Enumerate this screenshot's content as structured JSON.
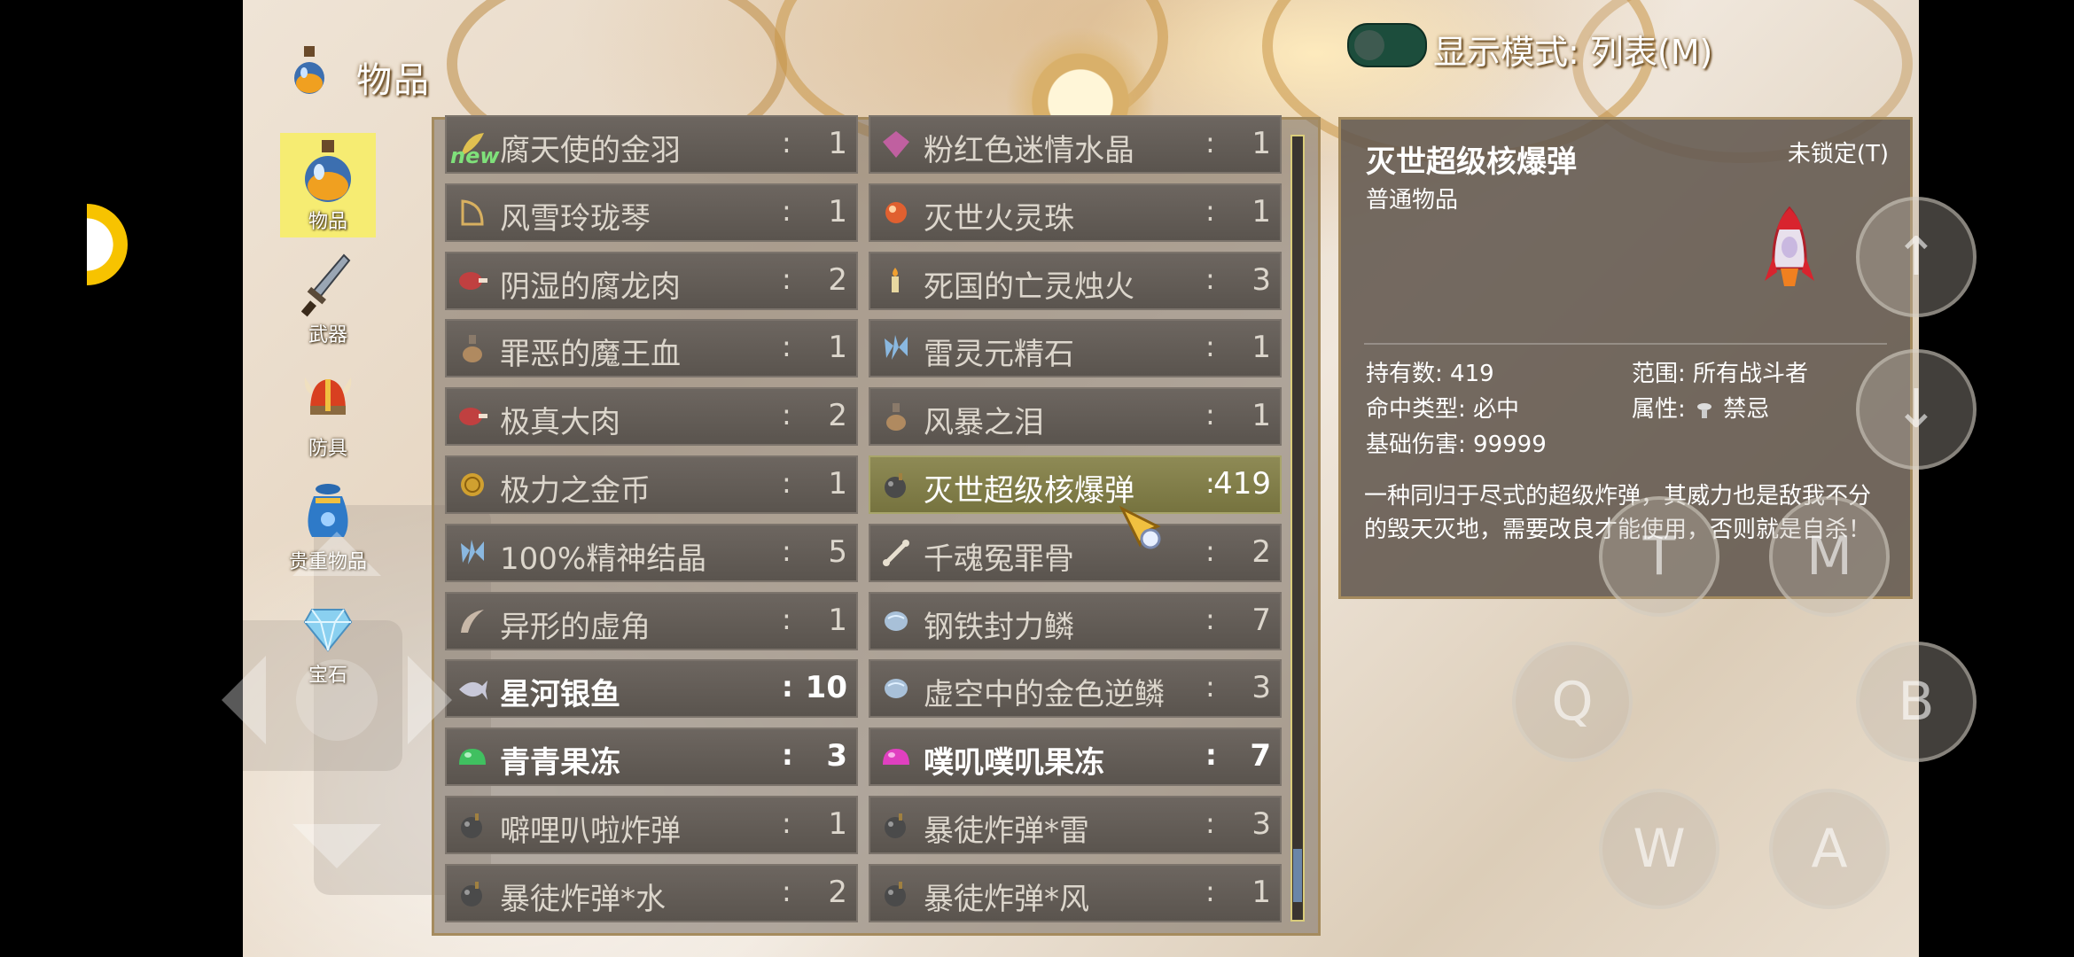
{
  "header": {
    "title": "物品"
  },
  "display_mode": {
    "label": "显示模式: 列表(M)",
    "toggle_on": false
  },
  "categories": [
    {
      "label": "物品",
      "icon": "potion-icon",
      "active": true
    },
    {
      "label": "武器",
      "icon": "sword-icon",
      "active": false
    },
    {
      "label": "防具",
      "icon": "helmet-icon",
      "active": false
    },
    {
      "label": "贵重物品",
      "icon": "treasure-bag-icon",
      "active": false
    },
    {
      "label": "宝石",
      "icon": "gem-icon",
      "active": false
    }
  ],
  "items": [
    {
      "name": "腐天使的金羽",
      "qty": "1",
      "icon": "feather-icon",
      "new_tag": "new"
    },
    {
      "name": "粉红色迷情水晶",
      "qty": "1",
      "icon": "crystal-icon"
    },
    {
      "name": "风雪玲珑琴",
      "qty": "1",
      "icon": "harp-icon"
    },
    {
      "name": "灭世火灵珠",
      "qty": "1",
      "icon": "orb-icon"
    },
    {
      "name": "阴湿的腐龙肉",
      "qty": "2",
      "icon": "meat-icon"
    },
    {
      "name": "死国的亡灵烛火",
      "qty": "3",
      "icon": "candle-icon"
    },
    {
      "name": "罪恶的魔王血",
      "qty": "1",
      "icon": "flask-icon"
    },
    {
      "name": "雷灵元精石",
      "qty": "1",
      "icon": "shard-icon"
    },
    {
      "name": "极真大肉",
      "qty": "2",
      "icon": "meat-icon"
    },
    {
      "name": "风暴之泪",
      "qty": "1",
      "icon": "flask-icon"
    },
    {
      "name": "极力之金币",
      "qty": "1",
      "icon": "coin-icon"
    },
    {
      "name": "灭世超级核爆弹",
      "qty": "419",
      "icon": "bomb-icon",
      "selected": true
    },
    {
      "name": "100%精神结晶",
      "qty": "5",
      "icon": "shard-icon"
    },
    {
      "name": "千魂冤罪骨",
      "qty": "2",
      "icon": "bone-icon"
    },
    {
      "name": "异形的虚角",
      "qty": "1",
      "icon": "horn-icon"
    },
    {
      "name": "钢铁封力鳞",
      "qty": "7",
      "icon": "scale-icon"
    },
    {
      "name": "星河银鱼",
      "qty": "10",
      "icon": "fish-icon",
      "bright": true
    },
    {
      "name": "虚空中的金色逆鳞",
      "qty": "3",
      "icon": "scale-icon"
    },
    {
      "name": "青青果冻",
      "qty": "3",
      "icon": "jelly-green-icon",
      "bright": true
    },
    {
      "name": "噗叽噗叽果冻",
      "qty": "7",
      "icon": "jelly-pink-icon",
      "bright": true
    },
    {
      "name": "噼哩叭啦炸弹",
      "qty": "1",
      "icon": "bomb-icon"
    },
    {
      "name": "暴徒炸弹*雷",
      "qty": "3",
      "icon": "bomb-icon"
    },
    {
      "name": "暴徒炸弹*水",
      "qty": "2",
      "icon": "bomb-icon"
    },
    {
      "name": "暴徒炸弹*风",
      "qty": "1",
      "icon": "bomb-icon"
    }
  ],
  "detail": {
    "title": "灭世超级核爆弹",
    "lock": "未锁定(T)",
    "type": "普通物品",
    "held": "持有数: 419",
    "range": "范围: 所有战斗者",
    "hit": "命中类型: 必中",
    "attr_label": "属性:",
    "attr_value": "禁忌",
    "damage": "基础伤害: 99999",
    "desc": "一种同归于尽式的超级炸弹，其威力也是敌我不分的毁天灭地，需要改良才能使用，否则就是自杀！",
    "image": "rocket-icon"
  },
  "controls": {
    "up": "↑",
    "down": "↓",
    "t": "T",
    "m": "M",
    "q": "Q",
    "b": "B",
    "w": "W",
    "a": "A"
  },
  "colors": {
    "active_category": "#f6ec72",
    "selected_row": "#8e8a55",
    "toggle": "#1c4d3c",
    "scrollbar_thumb": "#6a86a8"
  }
}
